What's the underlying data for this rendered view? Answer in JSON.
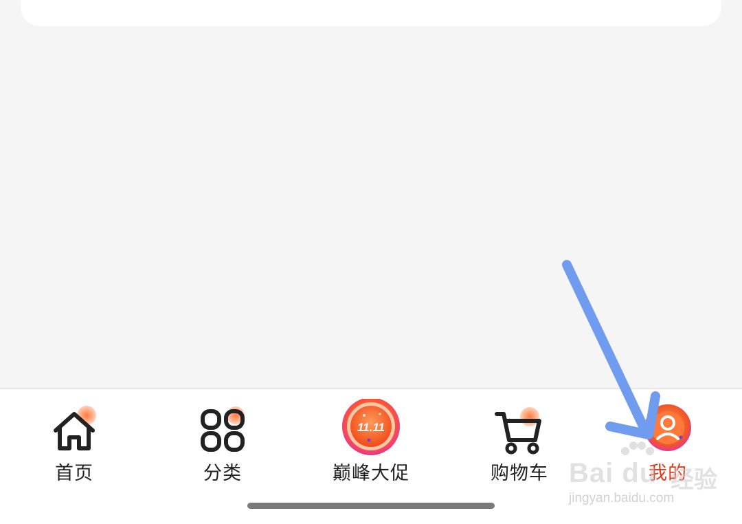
{
  "tabbar": {
    "tabs": [
      {
        "label": "首页",
        "icon": "home-icon"
      },
      {
        "label": "分类",
        "icon": "category-grid-icon"
      },
      {
        "label": "巅峰大促",
        "icon": "promo-1111-badge-icon",
        "badge_text": "11.11"
      },
      {
        "label": "购物车",
        "icon": "cart-icon"
      },
      {
        "label": "我的",
        "icon": "profile-icon",
        "selected": true
      }
    ]
  },
  "colors": {
    "accent": "#f26a2a",
    "accent_light": "#ff9a5a",
    "selected_label": "#e03a1a",
    "annotation_arrow": "#6f9cef",
    "background": "#f5f5f5"
  },
  "watermark": {
    "brand": "Bai du",
    "brand_cn": "经验",
    "url": "jingyan.baidu.com"
  }
}
